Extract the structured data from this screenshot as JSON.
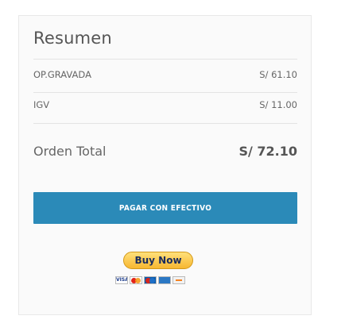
{
  "summary": {
    "title": "Resumen",
    "rows": [
      {
        "label": "OP.GRAVADA",
        "amount": "S/ 61.10"
      },
      {
        "label": "IGV",
        "amount": "S/ 11.00"
      }
    ],
    "total": {
      "label": "Orden Total",
      "amount": "S/ 72.10"
    }
  },
  "actions": {
    "pay_cash_label": "PAGAR CON EFECTIVO",
    "paypal_label": "Buy Now"
  },
  "payment_cards": {
    "visa_text": "VISA",
    "icons": [
      "visa-card-icon",
      "mastercard-icon",
      "maestro-icon",
      "amex-card-icon",
      "discover-card-icon"
    ]
  },
  "colors": {
    "accent": "#2b8ab8",
    "paypal_gold": "#f7b731"
  }
}
